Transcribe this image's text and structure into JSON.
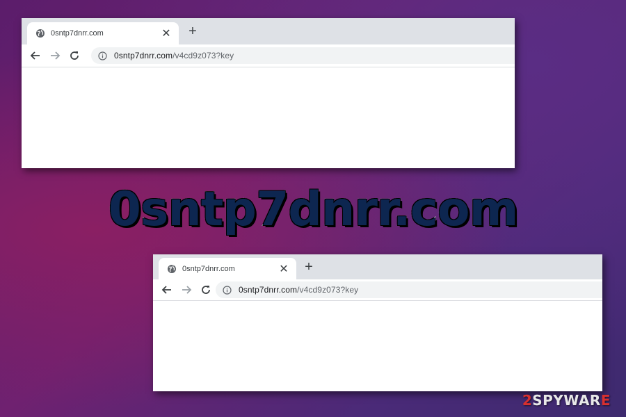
{
  "headline": "0sntp7dnrr.com",
  "watermark": {
    "prefix": "2",
    "middle": "SPYWAR",
    "suffix": "E"
  },
  "windows": [
    {
      "tab": {
        "title": "0sntp7dnrr.com",
        "icon": "globe-icon",
        "close": "✕"
      },
      "new_tab": "+",
      "url": {
        "host": "0sntp7dnrr.com",
        "path": "/v4cd9z073?key"
      }
    },
    {
      "tab": {
        "title": "0sntp7dnrr.com",
        "icon": "globe-icon",
        "close": "✕"
      },
      "new_tab": "+",
      "url": {
        "host": "0sntp7dnrr.com",
        "path": "/v4cd9z073?key"
      }
    }
  ],
  "colors": {
    "headline": "#0d2650",
    "accent": "#d8302f"
  }
}
